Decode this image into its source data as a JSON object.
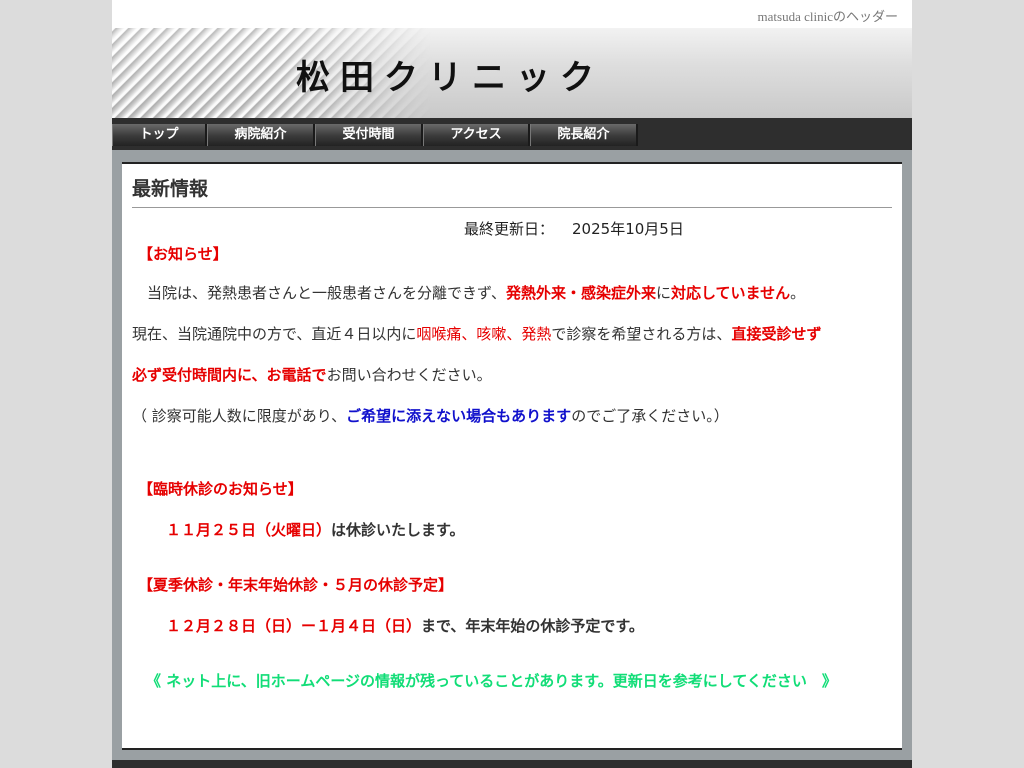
{
  "header": {
    "top_text": "matsuda clinicのヘッダー",
    "title": "松田クリニック"
  },
  "nav": {
    "items": [
      {
        "label": "トップ",
        "width": 95
      },
      {
        "label": "病院紹介",
        "width": 108
      },
      {
        "label": "受付時間",
        "width": 108
      },
      {
        "label": "アクセス",
        "width": 107
      },
      {
        "label": "院長紹介",
        "width": 108
      }
    ]
  },
  "main": {
    "heading": "最新情報",
    "updated_label": "最終更新日：",
    "updated_value": "2025年10月5日",
    "notice_title": "【お知らせ】",
    "p1_a": "　当院は、発熱患者さんと一般患者さんを分離できず、",
    "p1_b": "発熱外来・感染症外来",
    "p1_c": "に",
    "p1_d": "対応していません",
    "p1_e": "。",
    "p2_a": "現在、当院通院中の方で、直近４日以内に",
    "p2_b": "咽喉痛、咳嗽、発熱",
    "p2_c": "で診察を希望される方は、",
    "p2_d": "直接受診せず",
    "p3_a": "必ず受付時間内に、お電話で",
    "p3_b": "お問い合わせください。",
    "p4_a": "（ 診察可能人数に限度があり、",
    "p4_b": "ご希望に添えない場合もあります",
    "p4_c": "のでご了承ください。）",
    "temp_title": "【臨時休診のお知らせ】",
    "temp_a": "１１月２５日（",
    "temp_b": "火曜日",
    "temp_c": "）",
    "temp_d": "は休診いたします。",
    "season_title": "【夏季休診・年末年始休診・５月の休診予定】",
    "season_a": "１２月２８日（日）ー１月４日（日）",
    "season_b": "まで、年末年始の休診予定です。",
    "green_note": "《 ネット上に、旧ホームページの情報が残っていることがあります。更新日を参考にしてください　》"
  },
  "colors": {
    "red": "#e60000",
    "blue": "#1111cc",
    "green": "#11dd77",
    "nav_bg": "#2e2e2e"
  }
}
